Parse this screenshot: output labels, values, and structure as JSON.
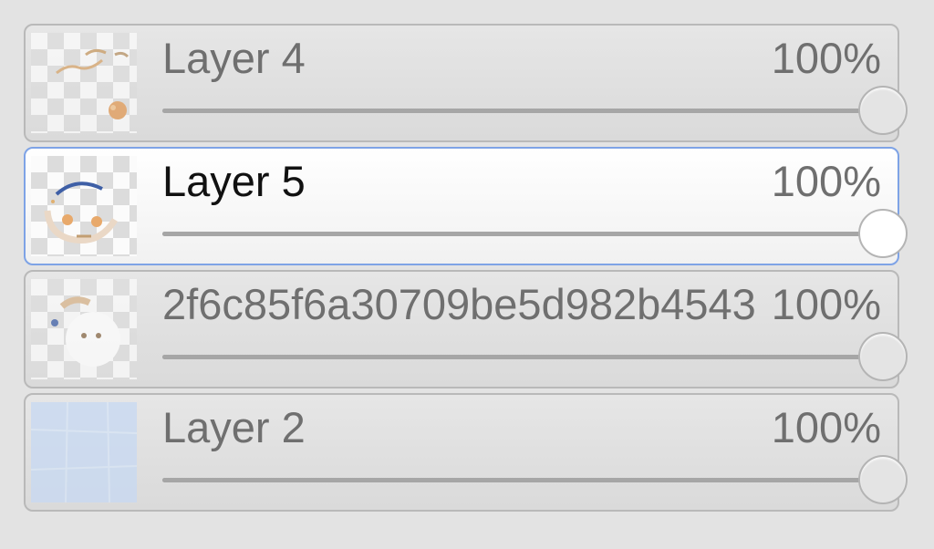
{
  "layers": [
    {
      "name": "Layer 4",
      "opacity_label": "100%",
      "opacity": 1.0,
      "selected": false,
      "thumbnail": "sketch-thumbnail"
    },
    {
      "name": "Layer 5",
      "opacity_label": "100%",
      "opacity": 1.0,
      "selected": true,
      "thumbnail": "circle-sketch-thumbnail"
    },
    {
      "name": "2f6c85f6a30709be5d982b4543",
      "opacity_label": "100%",
      "opacity": 1.0,
      "selected": false,
      "thumbnail": "character-thumbnail"
    },
    {
      "name": "Layer 2",
      "opacity_label": "100%",
      "opacity": 1.0,
      "selected": false,
      "thumbnail": "blue-fill-thumbnail"
    }
  ],
  "colors": {
    "selected_border": "#7ea3e6",
    "panel_background": "#e3e3e3",
    "thumbnail_blue": "#c7d9f3"
  }
}
